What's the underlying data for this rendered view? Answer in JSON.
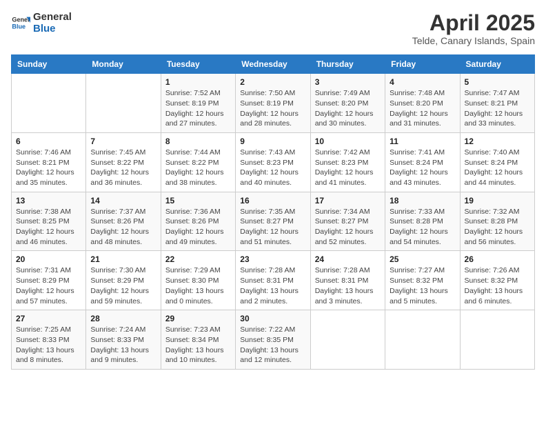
{
  "header": {
    "logo_line1": "General",
    "logo_line2": "Blue",
    "month": "April 2025",
    "location": "Telde, Canary Islands, Spain"
  },
  "days_of_week": [
    "Sunday",
    "Monday",
    "Tuesday",
    "Wednesday",
    "Thursday",
    "Friday",
    "Saturday"
  ],
  "weeks": [
    [
      {
        "num": "",
        "info": ""
      },
      {
        "num": "",
        "info": ""
      },
      {
        "num": "1",
        "info": "Sunrise: 7:52 AM\nSunset: 8:19 PM\nDaylight: 12 hours and 27 minutes."
      },
      {
        "num": "2",
        "info": "Sunrise: 7:50 AM\nSunset: 8:19 PM\nDaylight: 12 hours and 28 minutes."
      },
      {
        "num": "3",
        "info": "Sunrise: 7:49 AM\nSunset: 8:20 PM\nDaylight: 12 hours and 30 minutes."
      },
      {
        "num": "4",
        "info": "Sunrise: 7:48 AM\nSunset: 8:20 PM\nDaylight: 12 hours and 31 minutes."
      },
      {
        "num": "5",
        "info": "Sunrise: 7:47 AM\nSunset: 8:21 PM\nDaylight: 12 hours and 33 minutes."
      }
    ],
    [
      {
        "num": "6",
        "info": "Sunrise: 7:46 AM\nSunset: 8:21 PM\nDaylight: 12 hours and 35 minutes."
      },
      {
        "num": "7",
        "info": "Sunrise: 7:45 AM\nSunset: 8:22 PM\nDaylight: 12 hours and 36 minutes."
      },
      {
        "num": "8",
        "info": "Sunrise: 7:44 AM\nSunset: 8:22 PM\nDaylight: 12 hours and 38 minutes."
      },
      {
        "num": "9",
        "info": "Sunrise: 7:43 AM\nSunset: 8:23 PM\nDaylight: 12 hours and 40 minutes."
      },
      {
        "num": "10",
        "info": "Sunrise: 7:42 AM\nSunset: 8:23 PM\nDaylight: 12 hours and 41 minutes."
      },
      {
        "num": "11",
        "info": "Sunrise: 7:41 AM\nSunset: 8:24 PM\nDaylight: 12 hours and 43 minutes."
      },
      {
        "num": "12",
        "info": "Sunrise: 7:40 AM\nSunset: 8:24 PM\nDaylight: 12 hours and 44 minutes."
      }
    ],
    [
      {
        "num": "13",
        "info": "Sunrise: 7:38 AM\nSunset: 8:25 PM\nDaylight: 12 hours and 46 minutes."
      },
      {
        "num": "14",
        "info": "Sunrise: 7:37 AM\nSunset: 8:26 PM\nDaylight: 12 hours and 48 minutes."
      },
      {
        "num": "15",
        "info": "Sunrise: 7:36 AM\nSunset: 8:26 PM\nDaylight: 12 hours and 49 minutes."
      },
      {
        "num": "16",
        "info": "Sunrise: 7:35 AM\nSunset: 8:27 PM\nDaylight: 12 hours and 51 minutes."
      },
      {
        "num": "17",
        "info": "Sunrise: 7:34 AM\nSunset: 8:27 PM\nDaylight: 12 hours and 52 minutes."
      },
      {
        "num": "18",
        "info": "Sunrise: 7:33 AM\nSunset: 8:28 PM\nDaylight: 12 hours and 54 minutes."
      },
      {
        "num": "19",
        "info": "Sunrise: 7:32 AM\nSunset: 8:28 PM\nDaylight: 12 hours and 56 minutes."
      }
    ],
    [
      {
        "num": "20",
        "info": "Sunrise: 7:31 AM\nSunset: 8:29 PM\nDaylight: 12 hours and 57 minutes."
      },
      {
        "num": "21",
        "info": "Sunrise: 7:30 AM\nSunset: 8:29 PM\nDaylight: 12 hours and 59 minutes."
      },
      {
        "num": "22",
        "info": "Sunrise: 7:29 AM\nSunset: 8:30 PM\nDaylight: 13 hours and 0 minutes."
      },
      {
        "num": "23",
        "info": "Sunrise: 7:28 AM\nSunset: 8:31 PM\nDaylight: 13 hours and 2 minutes."
      },
      {
        "num": "24",
        "info": "Sunrise: 7:28 AM\nSunset: 8:31 PM\nDaylight: 13 hours and 3 minutes."
      },
      {
        "num": "25",
        "info": "Sunrise: 7:27 AM\nSunset: 8:32 PM\nDaylight: 13 hours and 5 minutes."
      },
      {
        "num": "26",
        "info": "Sunrise: 7:26 AM\nSunset: 8:32 PM\nDaylight: 13 hours and 6 minutes."
      }
    ],
    [
      {
        "num": "27",
        "info": "Sunrise: 7:25 AM\nSunset: 8:33 PM\nDaylight: 13 hours and 8 minutes."
      },
      {
        "num": "28",
        "info": "Sunrise: 7:24 AM\nSunset: 8:33 PM\nDaylight: 13 hours and 9 minutes."
      },
      {
        "num": "29",
        "info": "Sunrise: 7:23 AM\nSunset: 8:34 PM\nDaylight: 13 hours and 10 minutes."
      },
      {
        "num": "30",
        "info": "Sunrise: 7:22 AM\nSunset: 8:35 PM\nDaylight: 13 hours and 12 minutes."
      },
      {
        "num": "",
        "info": ""
      },
      {
        "num": "",
        "info": ""
      },
      {
        "num": "",
        "info": ""
      }
    ]
  ]
}
